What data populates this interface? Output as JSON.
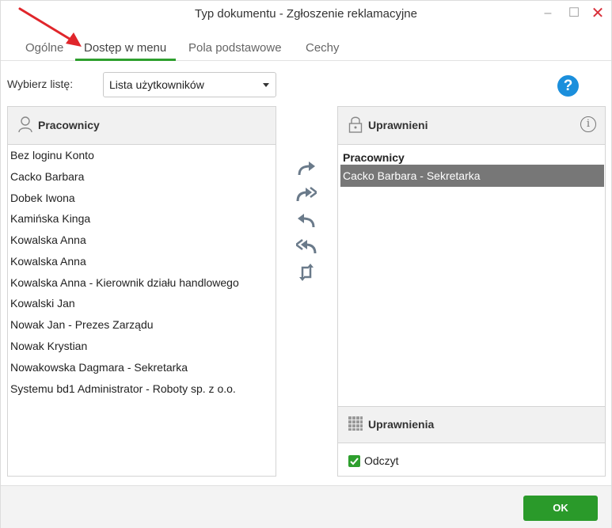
{
  "window": {
    "title": "Typ dokumentu - Zgłoszenie reklamacyjne",
    "controls": {
      "minimize": "–",
      "maximize": "☐",
      "close": "✕"
    }
  },
  "tabs": [
    {
      "label": "Ogólne"
    },
    {
      "label": "Dostęp w menu",
      "active": true
    },
    {
      "label": "Pola podstawowe"
    },
    {
      "label": "Cechy"
    }
  ],
  "list_selector": {
    "label": "Wybierz listę:",
    "value": "Lista użytkowników"
  },
  "help": {
    "glyph": "?"
  },
  "left_panel": {
    "title": "Pracownicy",
    "icon": "person-icon",
    "items": [
      "Bez loginu Konto",
      "Cacko Barbara",
      "Dobek Iwona",
      "Kamińska Kinga",
      "Kowalska Anna",
      "Kowalska Anna",
      "Kowalska Anna - Kierownik działu handlowego",
      "Kowalski Jan",
      "Nowak Jan - Prezes Zarządu",
      "Nowak Krystian",
      "Nowakowska Dagmara - Sekretarka",
      "Systemu bd1 Administrator - Roboty sp. z o.o."
    ]
  },
  "transfer_buttons": [
    "move-right-icon",
    "move-all-right-icon",
    "move-left-icon",
    "move-all-left-icon",
    "refresh-icon"
  ],
  "right_panel": {
    "title": "Uprawnieni",
    "icon": "lock-icon",
    "info_glyph": "i",
    "group_label": "Pracownicy",
    "selected_item": "Cacko Barbara - Sekretarka"
  },
  "permissions": {
    "title": "Uprawnienia",
    "icon": "grid-icon",
    "checkbox_label": "Odczyt",
    "checked": true
  },
  "footer": {
    "ok_label": "OK"
  },
  "colors": {
    "accent_green": "#2e9f2e",
    "selected_row": "#777777",
    "help_blue": "#1b8fdc",
    "close_red": "#d9303a",
    "annotation_red": "#e0262b"
  }
}
